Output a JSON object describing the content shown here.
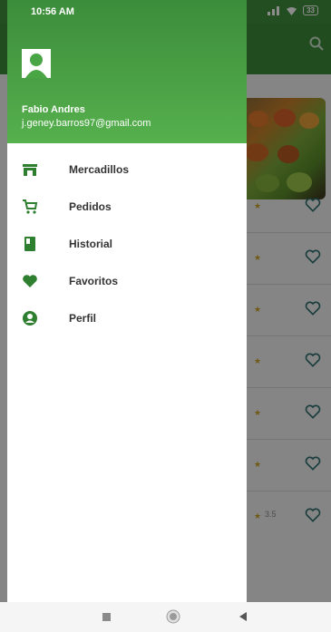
{
  "status_bar": {
    "time": "10:56 AM",
    "battery": "33"
  },
  "drawer": {
    "user_name": "Fabio Andres",
    "user_email": "j.geney.barros97@gmail.com",
    "menu": [
      {
        "label": "Mercadillos",
        "icon": "store-icon"
      },
      {
        "label": "Pedidos",
        "icon": "cart-icon"
      },
      {
        "label": "Historial",
        "icon": "book-icon"
      },
      {
        "label": "Favoritos",
        "icon": "heart-icon"
      },
      {
        "label": "Perfil",
        "icon": "account-circle-icon"
      }
    ]
  },
  "product_list": {
    "visible_ratings": [
      "",
      "",
      "",
      "",
      "",
      "",
      "3.5"
    ]
  },
  "colors": {
    "primary": "#3c8b39",
    "header_gradient_top": "#3c8d3b",
    "header_gradient_bottom": "#56b04d",
    "icon_green": "#2f7f30",
    "star": "#c9a227"
  }
}
